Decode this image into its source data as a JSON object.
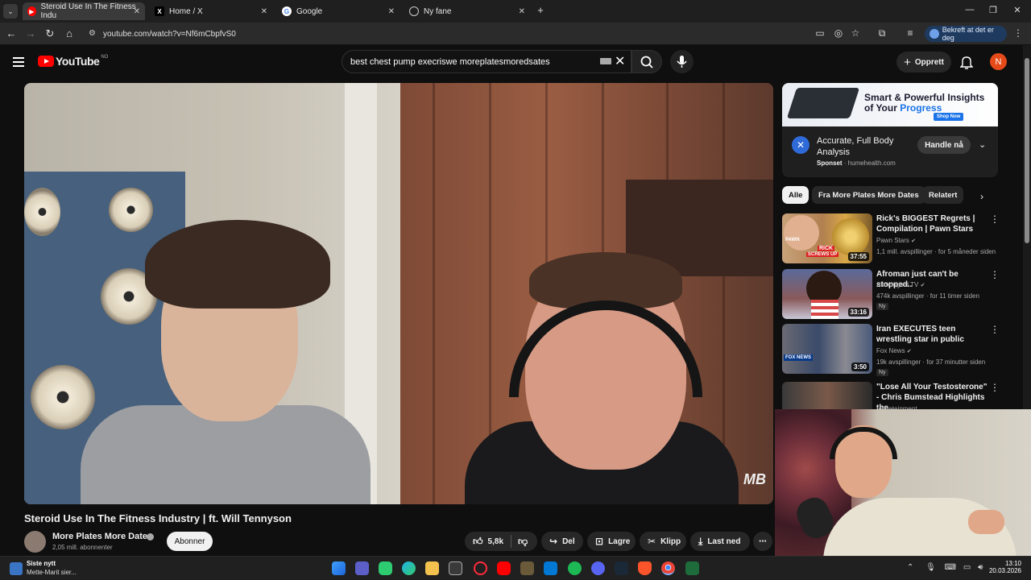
{
  "browser": {
    "tabs": [
      {
        "title": "Steroid Use In The Fitness Indu",
        "icon": "youtube-icon",
        "active": true
      },
      {
        "title": "Home / X",
        "icon": "x-icon",
        "active": false
      },
      {
        "title": "Google",
        "icon": "google-icon",
        "active": false
      },
      {
        "title": "Ny fane",
        "icon": "globe-icon",
        "active": false
      }
    ],
    "new_tab": "+",
    "url": "youtube.com/watch?v=Nf6mCbpfvS0",
    "profile_chip": "Bekreft at det er deg"
  },
  "header": {
    "logo_text": "YouTube",
    "country": "NO",
    "search_value": "best chest pump execriswe moreplatesmoredsates",
    "create_label": "Opprett",
    "avatar_letter": "N"
  },
  "video": {
    "title": "Steroid Use In The Fitness Industry | ft. Will Tennyson",
    "watermark": "MB",
    "channel": {
      "name": "More Plates More Dates",
      "subscribers": "2,05 mill. abonnenter",
      "subscribe_label": "Abonner"
    },
    "actions": {
      "likes": "5,8k",
      "share": "Del",
      "save": "Lagre",
      "clip": "Klipp",
      "download": "Last ned"
    }
  },
  "ad": {
    "headline_1": "Smart & Powerful Insights",
    "headline_2a": "of Your ",
    "headline_2b": "Progress",
    "shop_now": "Shop Now",
    "title": "Accurate, Full Body Analysis",
    "sponsored": "Sponset",
    "domain": "humehealth.com",
    "cta": "Handle nå"
  },
  "chips": [
    "Alle",
    "Fra More Plates More Dates",
    "Relatert"
  ],
  "recommendations": [
    {
      "title": "Rick's BIGGEST Regrets | Compilation | Pawn Stars",
      "channel": "Pawn Stars",
      "meta": "1,1 mill. avspillinger · for 5 måneder siden",
      "duration": "37:55",
      "badge": "",
      "thumb_text_1": "RICK",
      "thumb_text_2": "SCREWS UP",
      "thumb_text_3": "PAWN"
    },
    {
      "title": "Afroman just can't be stopped..",
      "channel": "Asmongold TV",
      "meta": "474k avspillinger · for 11 timer siden",
      "duration": "33:16",
      "badge": "Ny"
    },
    {
      "title": "Iran EXECUTES teen wrestling star in public",
      "channel": "Fox News",
      "meta": "19k avspillinger · for 37 minutter siden",
      "duration": "3:50",
      "badge": "Ny",
      "thumb_text_1": "FOX NEWS"
    },
    {
      "title": "\"Lose All Your Testosterone\" - Chris Bumstead Highlights the...",
      "channel": "Valuetainment",
      "meta": "",
      "duration": "",
      "badge": ""
    }
  ],
  "taskbar": {
    "news_title": "Siste nytt",
    "news_sub": "Mette-Marit sier...",
    "time": "13:10",
    "date": "20.03.2026"
  },
  "colors": {
    "youtube_red": "#ff0000",
    "background": "#0f0f0f",
    "avatar": "#e64a19",
    "ad_accent": "#1a73e8"
  }
}
